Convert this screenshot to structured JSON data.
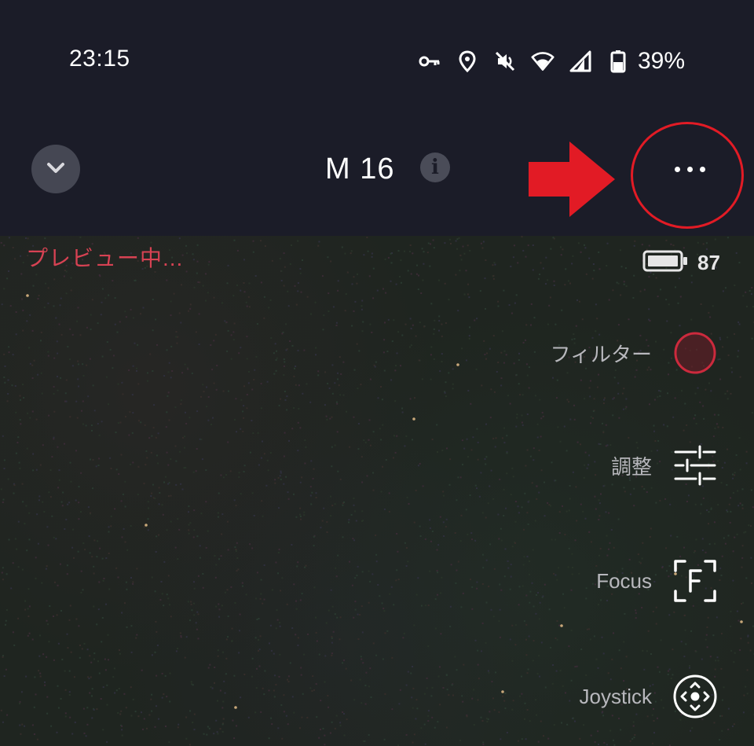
{
  "status_bar": {
    "time": "23:15",
    "icons": [
      "vpn-key-icon",
      "location-icon",
      "mute-icon",
      "wifi-icon",
      "signal-icon",
      "battery-icon"
    ],
    "battery_percent": "39%"
  },
  "app_bar": {
    "title": "M 16",
    "info_icon": "info-icon",
    "back_icon": "chevron-down-icon",
    "more_icon": "more-horizontal-icon",
    "annotation_color": "#e21b25"
  },
  "viewer": {
    "status_label": "プレビュー中...",
    "battery_level": "87",
    "controls": [
      {
        "label": "フィルター",
        "icon": "filter-circle-icon"
      },
      {
        "label": "調整",
        "icon": "sliders-icon"
      },
      {
        "label": "Focus",
        "icon": "focus-f-icon"
      },
      {
        "label": "Joystick",
        "icon": "joystick-icon"
      }
    ]
  },
  "colors": {
    "background": "#1b1c28",
    "preview_text": "#d74253",
    "filter_accent": "#cc2a3d"
  }
}
